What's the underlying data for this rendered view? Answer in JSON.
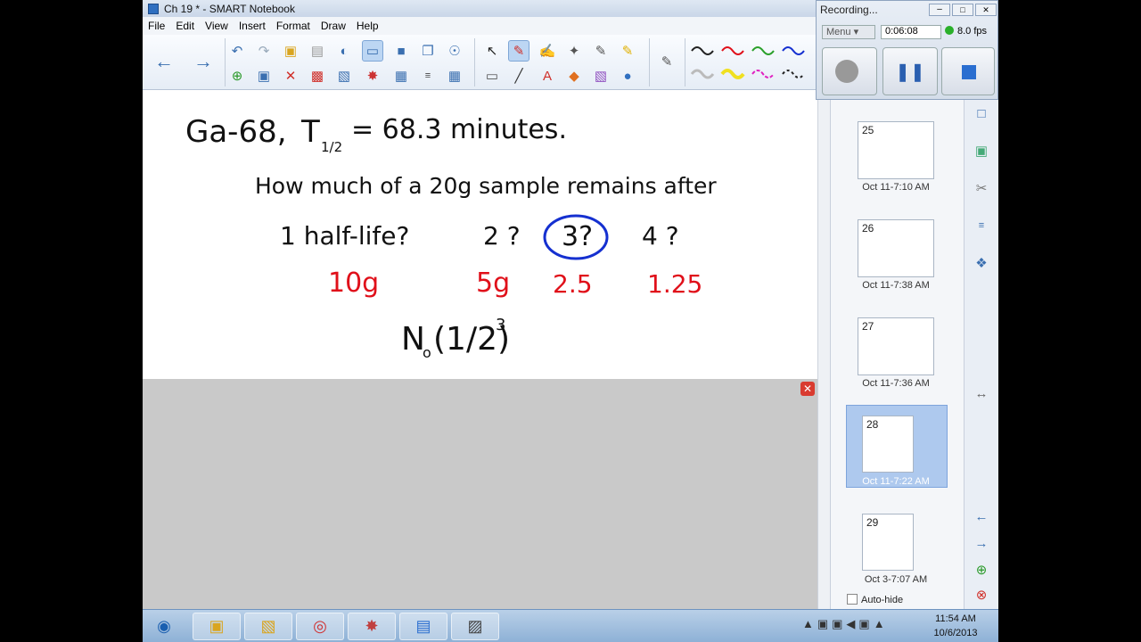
{
  "window": {
    "title": "Ch 19 * - SMART Notebook"
  },
  "menu": [
    "File",
    "Edit",
    "View",
    "Insert",
    "Format",
    "Draw",
    "Help"
  ],
  "recorder": {
    "title": "Recording...",
    "menu_label": "Menu",
    "elapsed": "0:06:08",
    "fps": "8.0 fps"
  },
  "page": {
    "line1a": "Ga-68,",
    "line1b": "T",
    "line1c": "1/2",
    "line1d": "= 68.3 minutes.",
    "line2": "How much of a 20g sample remains after",
    "q1": "1 half-life?",
    "q2": "2 ?",
    "q3": "3?",
    "q4": "4 ?",
    "a1": "10g",
    "a2": "5g",
    "a3": "2.5",
    "a4": "1.25",
    "formula_main": "N",
    "formula_sub": "o",
    "formula_paren": "(1/2)",
    "formula_exp": "3"
  },
  "colors": {
    "ink_black": "#111111",
    "ink_red": "#e0101a",
    "ink_blue": "#1530d0"
  },
  "thumbnails": [
    {
      "num": "25",
      "label": "Oct 11-7:10 AM"
    },
    {
      "num": "26",
      "label": "Oct 11-7:38 AM"
    },
    {
      "num": "27",
      "label": "Oct 11-7:36 AM"
    },
    {
      "num": "28",
      "label": "Oct 11-7:22 AM"
    },
    {
      "num": "29",
      "label": "Oct 3-7:07 AM"
    }
  ],
  "autohide_label": "Auto-hide",
  "taskbar": {
    "time": "11:54 AM",
    "date": "10/6/2013"
  }
}
